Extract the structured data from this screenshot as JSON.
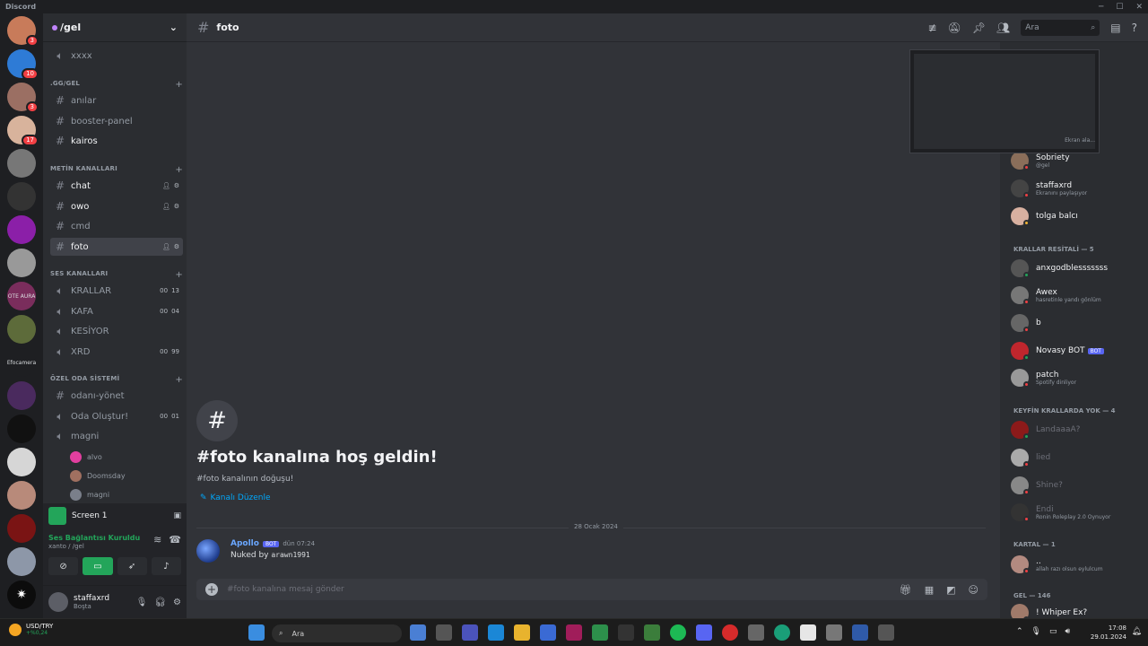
{
  "window": {
    "title": "Discord"
  },
  "guild": {
    "name": "/gel"
  },
  "channels": [
    {
      "label": "xxxx",
      "type": "voice",
      "state": "muted"
    },
    {
      "label": "anılar",
      "type": "text",
      "state": "muted"
    },
    {
      "label": "booster-panel",
      "type": "text",
      "state": "muted"
    },
    {
      "label": "kairos",
      "type": "text",
      "state": "unread"
    },
    {
      "label": "chat",
      "type": "text",
      "state": "unread"
    },
    {
      "label": "owo",
      "type": "text",
      "state": "unread"
    },
    {
      "label": "cmd",
      "type": "text",
      "state": "muted"
    },
    {
      "label": "foto",
      "type": "text",
      "state": "active"
    },
    {
      "label": "KRALLAR",
      "type": "voice",
      "count_a": "00",
      "count_b": "13"
    },
    {
      "label": "KAFA",
      "type": "voice",
      "count_a": "00",
      "count_b": "04"
    },
    {
      "label": "KESİYOR",
      "type": "voice"
    },
    {
      "label": "XRD",
      "type": "voice",
      "count_a": "00",
      "count_b": "99"
    },
    {
      "label": "odanı-yönet",
      "type": "text",
      "state": "muted"
    },
    {
      "label": "Oda Oluştur!",
      "type": "voice",
      "count_a": "00",
      "count_b": "01"
    },
    {
      "label": "magni",
      "type": "voice"
    }
  ],
  "categories": [
    ".GG/GEL",
    "METİN KANALLARI",
    "SES KANALLARI",
    "ÖZEL ODA SİSTEMİ"
  ],
  "voice_users": [
    "alvo",
    "Doomsday",
    "magni"
  ],
  "screen_share": {
    "label": "Screen 1"
  },
  "voice_panel": {
    "status": "Ses Bağlantısı Kuruldu",
    "location": "xanto / /gel"
  },
  "user_panel": {
    "name": "staffaxrd",
    "status": "Boşta"
  },
  "channel_header": {
    "name": "foto",
    "search_placeholder": "Ara"
  },
  "welcome": {
    "title": "#foto kanalına hoş geldin!",
    "subtitle": "#foto kanalının doğuşu!",
    "edit_link": "Kanalı Düzenle"
  },
  "date_divider": "28 Ocak 2024",
  "message": {
    "author": "Apollo",
    "badge": "BOT",
    "time": "dün 07:24",
    "text": "Nuked by",
    "code": "arawn1991"
  },
  "composer": {
    "placeholder": "#foto kanalına mesaj gönder"
  },
  "members": {
    "top": [
      {
        "name": "Sobriety",
        "status": "@gel"
      },
      {
        "name": "staffaxrd",
        "status": "Ekranını paylaşıyor"
      },
      {
        "name": "tolga balcı",
        "status": ""
      }
    ],
    "group1": "KRALLAR RESİTALİ — 5",
    "group1_members": [
      {
        "name": "anxgodblesssssss",
        "status": ""
      },
      {
        "name": "Awex",
        "status": "hasretinle yandı gönlüm"
      },
      {
        "name": "b",
        "status": ""
      },
      {
        "name": "Novasy BOT",
        "status": "",
        "badge": "BOT"
      },
      {
        "name": "patch",
        "status": "Spotify dinliyor"
      }
    ],
    "group2": "KEYFİN KRALLARDA YOK — 4",
    "group2_members": [
      {
        "name": "LandaaaA?",
        "status": ""
      },
      {
        "name": "lied",
        "status": ""
      },
      {
        "name": "Shine?",
        "status": ""
      },
      {
        "name": "Endi",
        "status": "Ronin Roleplay 2.0 Oynuyor"
      }
    ],
    "group3": "KARTAL — 1",
    "group3_members": [
      {
        "name": "..",
        "status": "allah razı olsun eylulcum"
      }
    ],
    "group4": "GEL — 146",
    "group4_members": [
      {
        "name": "! Whiper Ex?",
        "status": ""
      }
    ]
  },
  "preview_caption": "Ekran ala...",
  "taskbar": {
    "ticker_symbol": "USD/TRY",
    "ticker_change": "+%0,24",
    "search": "Ara",
    "time": "17:08",
    "date": "29.01.2024"
  },
  "server_badges": [
    "3",
    "10",
    "3",
    "17"
  ],
  "server_labels": [
    "OTE AURA",
    "Efocamera"
  ]
}
